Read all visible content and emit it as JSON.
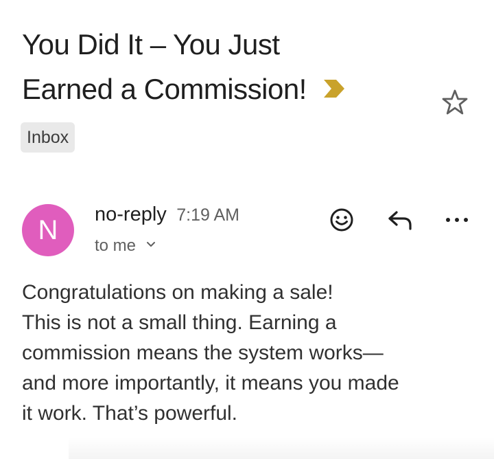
{
  "email": {
    "subject_line1": "You Did It – You Just",
    "subject_line2": "Earned a Commission!",
    "label": "Inbox",
    "importance_color": "#c9a22b",
    "sender": {
      "avatar_letter": "N",
      "avatar_color": "#e05dbd",
      "name": "no-reply",
      "time": "7:19 AM",
      "recipient": "to me"
    },
    "body_lines": [
      "Congratulations on making a sale!",
      "This is not a small thing. Earning a",
      "commission means the system works—",
      "and more importantly, it means you made",
      "it work. That’s powerful."
    ]
  },
  "icons": {
    "star": "star-outline-icon",
    "importance": "importance-marker-icon",
    "emoji": "add-reaction-icon",
    "reply": "reply-icon",
    "more": "more-options-icon",
    "recipient_details": "chevron-down-icon"
  }
}
